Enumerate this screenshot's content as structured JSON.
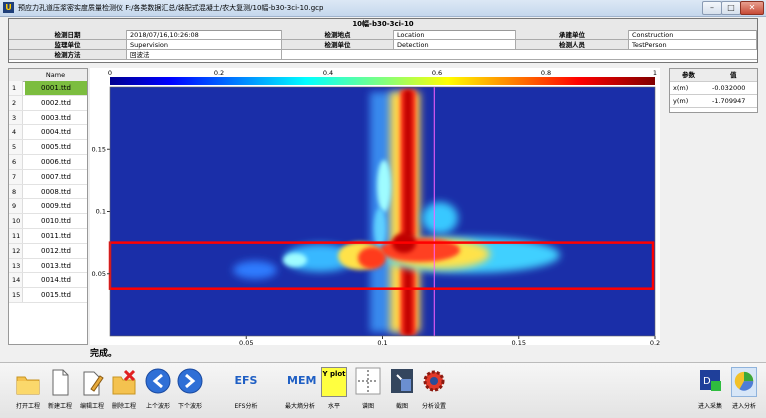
{
  "window": {
    "title": "预应力孔道压浆密实度质量检测仪   F:/各类数据汇总/装配式混凝土/农大复测/10幅-b30-3ci-10.gcp",
    "app_icon": "app-logo-icon"
  },
  "record": {
    "file_title": "10幅-b30-3ci-10",
    "fields": [
      {
        "label": "检测日期",
        "value": "2018/07/16,10:26:08"
      },
      {
        "label": "检测地点",
        "value": "Location"
      },
      {
        "label": "承建单位",
        "value": "Construction"
      },
      {
        "label": "监理单位",
        "value": "Supervision"
      },
      {
        "label": "检测单位",
        "value": "Detection"
      },
      {
        "label": "检测人员",
        "value": "TestPerson"
      },
      {
        "label": "检测方法",
        "value": "回波法"
      }
    ]
  },
  "file_list": {
    "header": "Name",
    "rows": [
      {
        "num": "1",
        "name": "0001.ttd"
      },
      {
        "num": "2",
        "name": "0002.ttd"
      },
      {
        "num": "3",
        "name": "0003.ttd"
      },
      {
        "num": "4",
        "name": "0004.ttd"
      },
      {
        "num": "5",
        "name": "0005.ttd"
      },
      {
        "num": "6",
        "name": "0006.ttd"
      },
      {
        "num": "7",
        "name": "0007.ttd"
      },
      {
        "num": "8",
        "name": "0008.ttd"
      },
      {
        "num": "9",
        "name": "0009.ttd"
      },
      {
        "num": "10",
        "name": "0010.ttd"
      },
      {
        "num": "11",
        "name": "0011.ttd"
      },
      {
        "num": "12",
        "name": "0012.ttd"
      },
      {
        "num": "13",
        "name": "0013.ttd"
      },
      {
        "num": "14",
        "name": "0014.ttd"
      },
      {
        "num": "15",
        "name": "0015.ttd"
      }
    ],
    "selected_index": 0,
    "selected_color": "#7cbd3f"
  },
  "chart_data": {
    "type": "heatmap",
    "colorbar": {
      "ticks": [
        "0",
        "0.2",
        "0.4",
        "0.6",
        "0.8",
        "1"
      ],
      "range": [
        0,
        1
      ]
    },
    "xaxis": {
      "range": [
        0,
        0.2
      ],
      "ticks": [
        "0.05",
        "0.1",
        "0.15",
        "0.2"
      ]
    },
    "yaxis": {
      "range": [
        0,
        0.2
      ],
      "ticks": [
        "0.05",
        "0.1",
        "0.15"
      ]
    },
    "highlight": {
      "y_range": [
        0.038,
        0.075
      ],
      "color": "#ff0000"
    },
    "marker_x": 0.119,
    "colors": {
      "low": "#1a2ea8",
      "high": "#c00000"
    }
  },
  "params": {
    "headers": [
      "参数",
      "值"
    ],
    "rows": [
      {
        "name": "x(m)",
        "value": "-0.032000"
      },
      {
        "name": "y(m)",
        "value": "-1.709947"
      }
    ]
  },
  "status": "完成。",
  "toolbar": {
    "buttons": [
      {
        "label": "打开工程",
        "icon": "folder-open-icon"
      },
      {
        "label": "新建工程",
        "icon": "new-file-icon"
      },
      {
        "label": "编辑工程",
        "icon": "edit-file-icon"
      },
      {
        "label": "删除工程",
        "icon": "delete-file-icon"
      },
      {
        "label": "上个波形",
        "icon": "arrow-left-icon"
      },
      {
        "label": "下个波形",
        "icon": "arrow-right-icon"
      },
      {
        "label": "EFS分析",
        "icon": "efs-icon",
        "text": "EFS"
      },
      {
        "label": "最大熵分析",
        "icon": "mem-icon",
        "text": "MEM"
      },
      {
        "label": "水平",
        "icon": "y-plot-icon",
        "text": "Y plot"
      },
      {
        "label": "谱图",
        "icon": "spectrum-icon"
      },
      {
        "label": "截图",
        "icon": "screenshot-icon"
      },
      {
        "label": "分析设置",
        "icon": "settings-gear-icon"
      },
      {
        "label": "进入采集",
        "icon": "acquisition-icon"
      },
      {
        "label": "进入分析",
        "icon": "analysis-pie-icon"
      }
    ]
  }
}
